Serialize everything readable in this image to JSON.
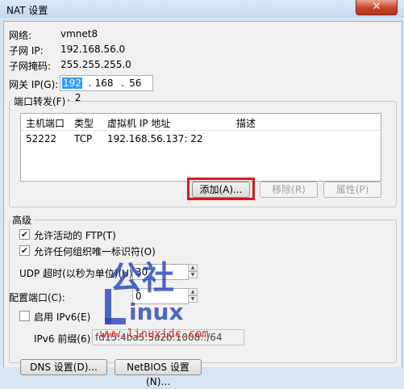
{
  "window": {
    "title": "NAT 设置",
    "close": "✕"
  },
  "info": {
    "network_label": "网络:",
    "network_value": "vmnet8",
    "subnet_ip_label": "子网 IP:",
    "subnet_ip_value": "192.168.56.0",
    "subnet_mask_label": "子网掩码:",
    "subnet_mask_value": "255.255.255.0",
    "gateway_label": "网关 IP(G):",
    "gateway_octets": [
      "192",
      "168",
      "56",
      "2"
    ]
  },
  "port_forwarding": {
    "title": "端口转发(F)",
    "columns": [
      "主机端口",
      "类型",
      "虚拟机 IP 地址",
      "描述"
    ],
    "rows": [
      {
        "host_port": "52222",
        "type": "TCP",
        "vm_address": "192.168.56.137: 22",
        "description": ""
      }
    ],
    "add_label": "添加(A)...",
    "remove_label": "移除(R)",
    "properties_label": "属性(P)"
  },
  "advanced": {
    "title": "高级",
    "allow_ftp_label": "允许活动的 FTP(T)",
    "allow_ftp_checked": true,
    "allow_oui_label": "允许任何组织唯一标识符(O)",
    "allow_oui_checked": true,
    "udp_timeout_label": "UDP 超时(以秒为单位)(U):",
    "udp_timeout_value": "30",
    "config_port_label": "配置端口(C):",
    "config_port_value": "0",
    "ipv6_label": "启用 IPv6(E)",
    "ipv6_checked": false,
    "ipv6_prefix_label": "IPv6 前缀(6):",
    "ipv6_prefix_value": "fd15:4ba5:5a2b:1008::/64"
  },
  "bottom": {
    "dns_label": "DNS 设置(D)...",
    "netbios_label": "NetBIOS 设置(N)..."
  },
  "watermark": {
    "chars": "公社",
    "word": "inux",
    "url": "www.linuxidc.com"
  }
}
